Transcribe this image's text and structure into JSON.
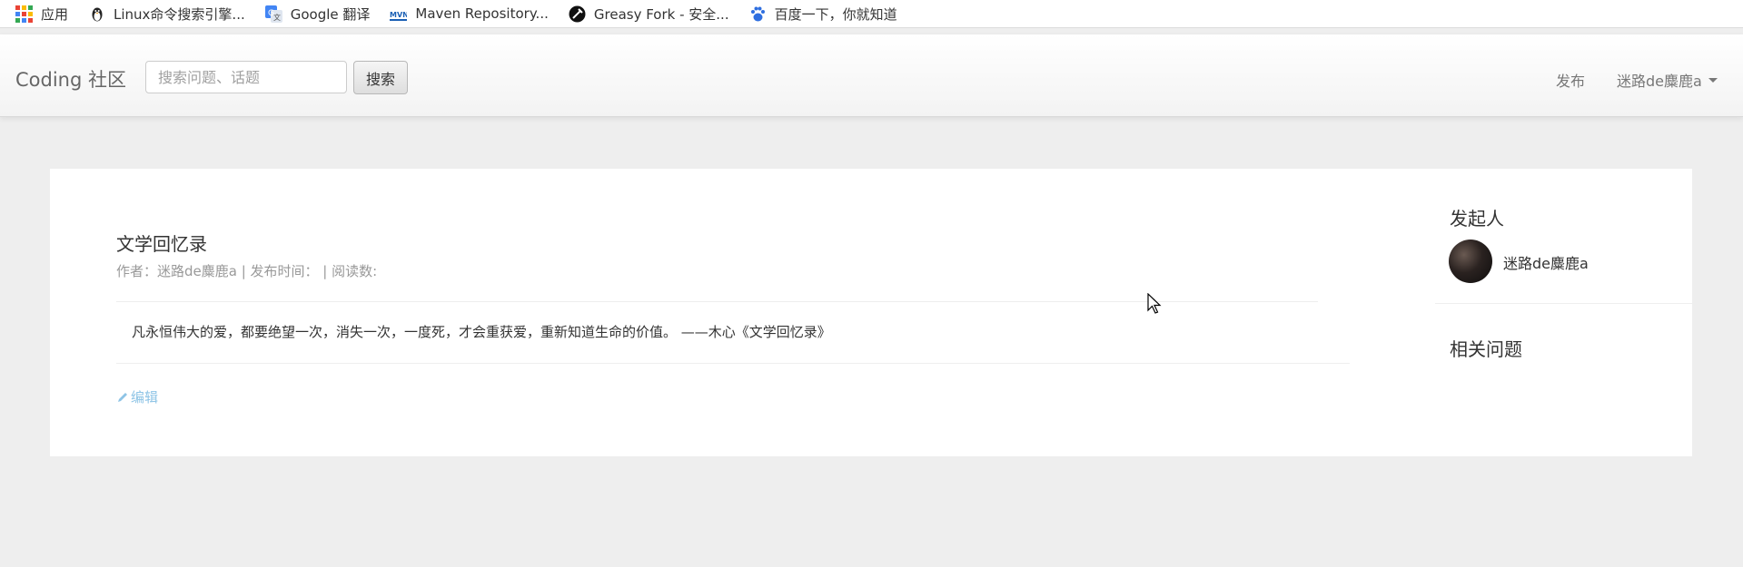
{
  "bookmarks": [
    {
      "label": "应用",
      "icon": "apps-grid-icon"
    },
    {
      "label": "Linux命令搜索引擎...",
      "icon": "penguin-icon"
    },
    {
      "label": "Google 翻译",
      "icon": "google-translate-icon"
    },
    {
      "label": "Maven Repository...",
      "icon": "maven-icon"
    },
    {
      "label": "Greasy Fork - 安全...",
      "icon": "greasyfork-icon"
    },
    {
      "label": "百度一下，你就知道",
      "icon": "baidu-paw-icon"
    }
  ],
  "navbar": {
    "brand": "Coding 社区",
    "search_placeholder": "搜索问题、话题",
    "search_button": "搜索",
    "publish": "发布",
    "user": "迷路de麋鹿a"
  },
  "question": {
    "title": "文学回忆录",
    "meta": "作者：迷路de麋鹿a | 发布时间： | 阅读数:",
    "body": "凡永恒伟大的爱，都要绝望一次，消失一次，一度死，才会重获爱，重新知道生命的价值。 ——木心《文学回忆录》",
    "edit": "编辑"
  },
  "sidebar": {
    "initiator_title": "发起人",
    "initiator_name": "迷路de麋鹿a",
    "related_title": "相关问题"
  },
  "colors": {
    "page_bg": "#eeeeee",
    "panel_bg": "#ffffff",
    "edit_link": "#8ec4e6",
    "muted_text": "#999999"
  }
}
